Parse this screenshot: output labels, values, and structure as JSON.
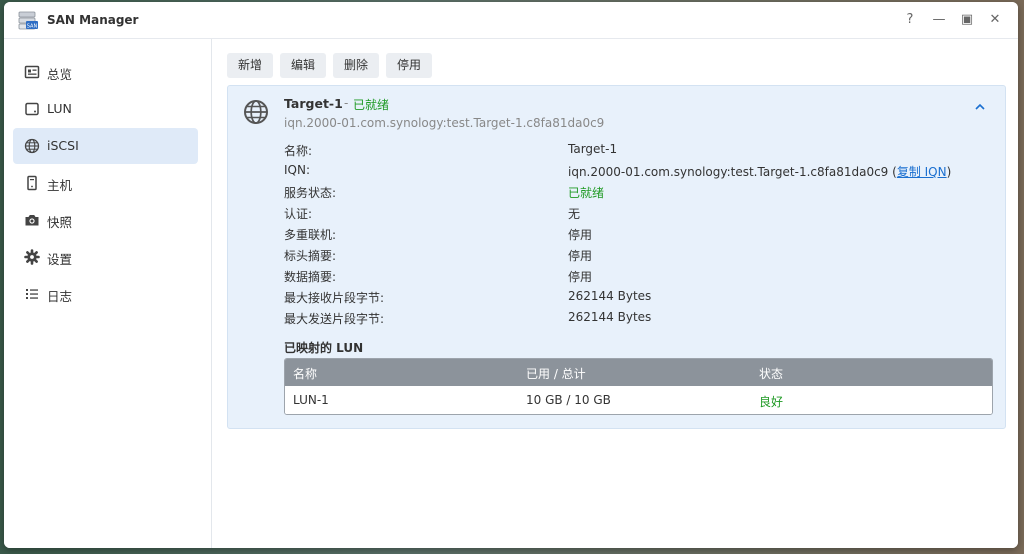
{
  "window": {
    "title": "SAN Manager",
    "controls": {
      "help": "?",
      "minimize": "—",
      "maximize": "▣",
      "close": "✕"
    }
  },
  "sidebar": {
    "items": [
      {
        "label": "总览",
        "icon": "overview-icon",
        "active": false
      },
      {
        "label": "LUN",
        "icon": "lun-icon",
        "active": false
      },
      {
        "label": "iSCSI",
        "icon": "globe-icon",
        "active": true
      },
      {
        "label": "主机",
        "icon": "host-icon",
        "active": false
      },
      {
        "label": "快照",
        "icon": "camera-icon",
        "active": false
      },
      {
        "label": "设置",
        "icon": "gear-icon",
        "active": false
      },
      {
        "label": "日志",
        "icon": "list-icon",
        "active": false
      }
    ]
  },
  "toolbar": {
    "add_label": "新增",
    "edit_label": "编辑",
    "delete_label": "删除",
    "disable_label": "停用"
  },
  "target": {
    "name": "Target-1",
    "dash": "-",
    "status": "已就绪",
    "iqn": "iqn.2000-01.com.synology:test.Target-1.c8fa81da0c9",
    "details": {
      "name_label": "名称:",
      "name_value": "Target-1",
      "iqn_label": "IQN:",
      "iqn_value": "iqn.2000-01.com.synology:test.Target-1.c8fa81da0c9",
      "iqn_open": " (",
      "copy_iqn": "复制 IQN",
      "iqn_close": ")",
      "service_label": "服务状态:",
      "service_value": "已就绪",
      "auth_label": "认证:",
      "auth_value": "无",
      "multi_label": "多重联机:",
      "multi_value": "停用",
      "header_digest_label": "标头摘要:",
      "header_digest_value": "停用",
      "data_digest_label": "数据摘要:",
      "data_digest_value": "停用",
      "max_recv_label": "最大接收片段字节:",
      "max_recv_value": "262144 Bytes",
      "max_send_label": "最大发送片段字节:",
      "max_send_value": "262144 Bytes"
    },
    "mapped_lun_title": "已映射的 LUN",
    "lun_table": {
      "headers": [
        "名称",
        "已用 / 总计",
        "状态"
      ],
      "rows": [
        [
          "LUN-1",
          "10 GB / 10 GB",
          "良好"
        ]
      ]
    }
  },
  "colors": {
    "accent": "#1a6fd0",
    "status_ok": "#1f9a24",
    "active_bg": "#dfeaf8",
    "panel_bg": "#e8f1fb"
  }
}
